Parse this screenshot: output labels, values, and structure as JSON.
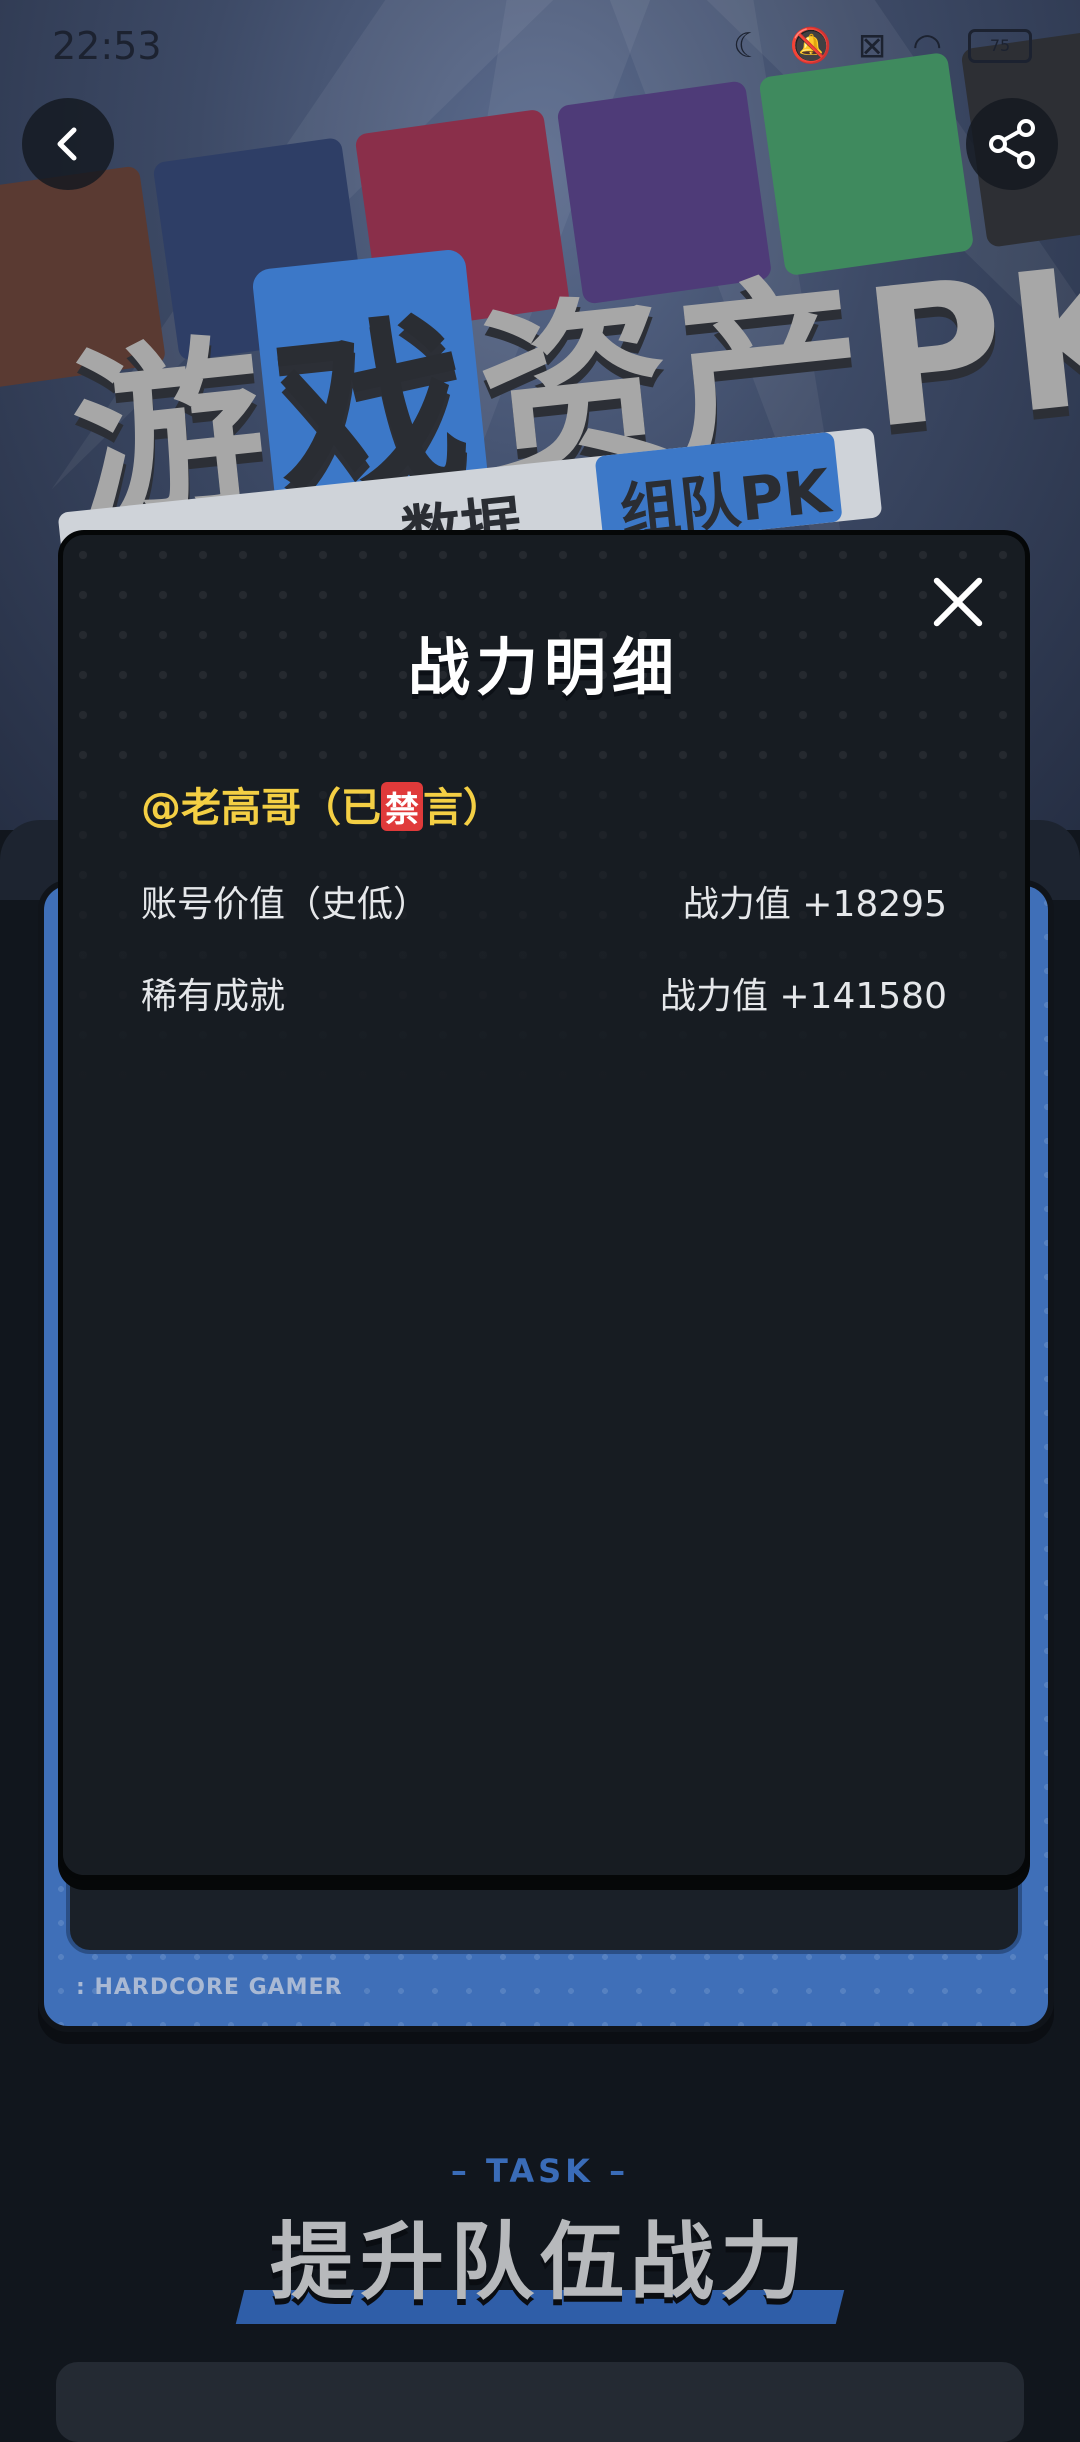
{
  "status_bar": {
    "time": "22:53",
    "battery": "75"
  },
  "banner": {
    "title_parts": [
      "游",
      "戏",
      "资产PK"
    ],
    "subtitle_left": "数据",
    "subtitle_right": "组队PK"
  },
  "card": {
    "tag": ": HARDCORE GAMER"
  },
  "modal": {
    "title": "战力明细",
    "user_prefix": "@老高哥（已",
    "user_ban": "禁",
    "user_suffix": "言）",
    "rows": [
      {
        "label": "账号价值（史低）",
        "value": "战力值 +18295"
      },
      {
        "label": "稀有成就",
        "value": "战力值 +141580"
      }
    ]
  },
  "task": {
    "tag": "– TASK –",
    "title": "提升队伍战力"
  },
  "colors": {
    "accent_blue": "#3d7fd8",
    "username_gold": "#f4cf44",
    "ban_red": "#e03a3a",
    "modal_bg": "#171c22"
  }
}
